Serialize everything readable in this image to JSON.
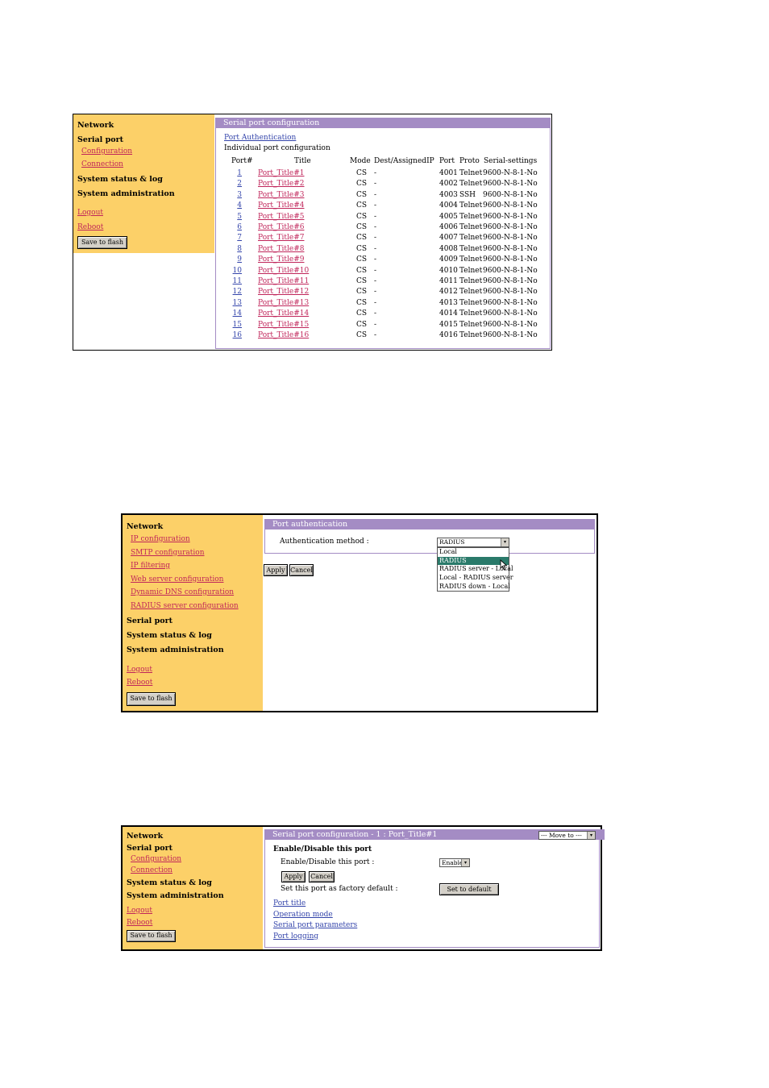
{
  "shot1": {
    "sidebar": {
      "network": "Network",
      "serial_port": "Serial port",
      "configuration": "Configuration",
      "connection": "Connection",
      "system_status": "System status & log",
      "system_admin": "System administration",
      "logout": "Logout",
      "reboot": "Reboot",
      "save": "Save to flash"
    },
    "header": "Serial port configuration",
    "auth_link": "Port Authentication",
    "subtitle": "Individual port configuration",
    "columns": [
      "Port#",
      "Title",
      "Mode",
      "Dest/AssignedIP",
      "Port",
      "Proto",
      "Serial-settings"
    ],
    "rows": [
      {
        "num": "1",
        "title": "Port_Title#1",
        "mode": "CS",
        "dest": "-",
        "port": "4001",
        "proto": "Telnet",
        "settings": "9600-N-8-1-No"
      },
      {
        "num": "2",
        "title": "Port_Title#2",
        "mode": "CS",
        "dest": "-",
        "port": "4002",
        "proto": "Telnet",
        "settings": "9600-N-8-1-No"
      },
      {
        "num": "3",
        "title": "Port_Title#3",
        "mode": "CS",
        "dest": "-",
        "port": "4003",
        "proto": "SSH",
        "settings": "9600-N-8-1-No"
      },
      {
        "num": "4",
        "title": "Port_Title#4",
        "mode": "CS",
        "dest": "-",
        "port": "4004",
        "proto": "Telnet",
        "settings": "9600-N-8-1-No"
      },
      {
        "num": "5",
        "title": "Port_Title#5",
        "mode": "CS",
        "dest": "-",
        "port": "4005",
        "proto": "Telnet",
        "settings": "9600-N-8-1-No"
      },
      {
        "num": "6",
        "title": "Port_Title#6",
        "mode": "CS",
        "dest": "-",
        "port": "4006",
        "proto": "Telnet",
        "settings": "9600-N-8-1-No"
      },
      {
        "num": "7",
        "title": "Port_Title#7",
        "mode": "CS",
        "dest": "-",
        "port": "4007",
        "proto": "Telnet",
        "settings": "9600-N-8-1-No"
      },
      {
        "num": "8",
        "title": "Port_Title#8",
        "mode": "CS",
        "dest": "-",
        "port": "4008",
        "proto": "Telnet",
        "settings": "9600-N-8-1-No"
      },
      {
        "num": "9",
        "title": "Port_Title#9",
        "mode": "CS",
        "dest": "-",
        "port": "4009",
        "proto": "Telnet",
        "settings": "9600-N-8-1-No"
      },
      {
        "num": "10",
        "title": "Port_Title#10",
        "mode": "CS",
        "dest": "-",
        "port": "4010",
        "proto": "Telnet",
        "settings": "9600-N-8-1-No"
      },
      {
        "num": "11",
        "title": "Port_Title#11",
        "mode": "CS",
        "dest": "-",
        "port": "4011",
        "proto": "Telnet",
        "settings": "9600-N-8-1-No"
      },
      {
        "num": "12",
        "title": "Port_Title#12",
        "mode": "CS",
        "dest": "-",
        "port": "4012",
        "proto": "Telnet",
        "settings": "9600-N-8-1-No"
      },
      {
        "num": "13",
        "title": "Port_Title#13",
        "mode": "CS",
        "dest": "-",
        "port": "4013",
        "proto": "Telnet",
        "settings": "9600-N-8-1-No"
      },
      {
        "num": "14",
        "title": "Port_Title#14",
        "mode": "CS",
        "dest": "-",
        "port": "4014",
        "proto": "Telnet",
        "settings": "9600-N-8-1-No"
      },
      {
        "num": "15",
        "title": "Port_Title#15",
        "mode": "CS",
        "dest": "-",
        "port": "4015",
        "proto": "Telnet",
        "settings": "9600-N-8-1-No"
      },
      {
        "num": "16",
        "title": "Port_Title#16",
        "mode": "CS",
        "dest": "-",
        "port": "4016",
        "proto": "Telnet",
        "settings": "9600-N-8-1-No"
      }
    ]
  },
  "shot2": {
    "sidebar": {
      "network": "Network",
      "links": [
        "IP configuration",
        "SMTP configuration",
        "IP filtering",
        "Web server configuration",
        "Dynamic DNS configuration",
        "RADIUS server configuration"
      ],
      "serial_port": "Serial port",
      "system_status": "System status & log",
      "system_admin": "System administration",
      "logout": "Logout",
      "reboot": "Reboot",
      "save": "Save to flash"
    },
    "header": "Port authentication",
    "auth_label": "Authentication method :",
    "auth_value": "RADIUS",
    "options": [
      "Local",
      "RADIUS",
      "RADIUS server - Local",
      "Local - RADIUS server",
      "RADIUS down - Local"
    ],
    "highlighted_option": "RADIUS",
    "apply": "Apply",
    "cancel": "Cancel"
  },
  "shot3": {
    "sidebar": {
      "network": "Network",
      "serial_port": "Serial port",
      "configuration": "Configuration",
      "connection": "Connection",
      "system_status": "System status & log",
      "system_admin": "System administration",
      "logout": "Logout",
      "reboot": "Reboot",
      "save": "Save to flash"
    },
    "header": "Serial port configuration - 1 : Port_Title#1",
    "move_to": "--- Move to ---",
    "section": "Enable/Disable this port",
    "enable_label": "Enable/Disable this port :",
    "enable_value": "Enable",
    "apply": "Apply",
    "cancel": "Cancel",
    "factory_label": "Set this port as factory default :",
    "set_default": "Set to default",
    "links": [
      "Port title",
      "Operation mode",
      "Serial port parameters",
      "Port logging"
    ]
  },
  "colors": {
    "sidebar": "#fcd068",
    "header": "#a48cc4",
    "link_red": "#c0255a",
    "link_blue": "#3344aa",
    "highlight": "#2a7a6a"
  }
}
